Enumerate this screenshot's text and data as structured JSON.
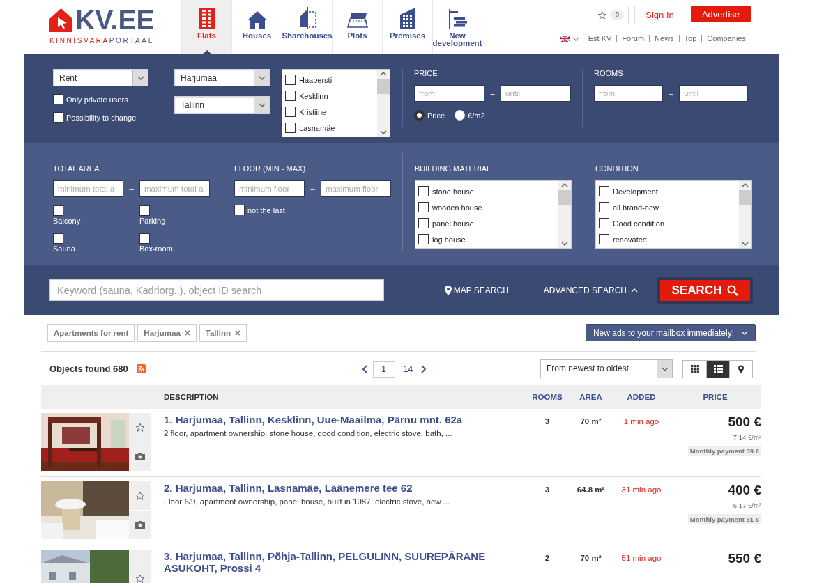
{
  "logo": {
    "brand": "KV.EE",
    "tagline_accent": "KINNISVARA",
    "tagline_rest": "PORTAAL"
  },
  "categories": [
    {
      "label": "Flats",
      "selected": true
    },
    {
      "label": "Houses",
      "selected": false
    },
    {
      "label": "Sharehouses",
      "selected": false
    },
    {
      "label": "Plots",
      "selected": false
    },
    {
      "label": "Premises",
      "selected": false
    },
    {
      "label": "New development",
      "selected": false
    }
  ],
  "account": {
    "favorites_count": "0",
    "sign_in": "Sign In",
    "advertise": "Advertise"
  },
  "top_links": [
    "Est KV",
    "Forum",
    "News",
    "Top",
    "Companies"
  ],
  "filters": {
    "deal": "Rent",
    "deal_options": [
      {
        "label": "Only private users",
        "checked": false
      },
      {
        "label": "Possibility to change",
        "checked": false
      }
    ],
    "county": "Harjumaa",
    "city": "Tallinn",
    "districts": [
      {
        "label": "Haabersti",
        "checked": false
      },
      {
        "label": "Kesklinn",
        "checked": false
      },
      {
        "label": "Kristiine",
        "checked": false
      },
      {
        "label": "Lasnamäe",
        "checked": false
      }
    ],
    "price": {
      "title": "PRICE",
      "from": {
        "placeholder": "from"
      },
      "until": {
        "placeholder": "until"
      },
      "dash": "–",
      "modes": [
        {
          "label": "Price",
          "selected": true
        },
        {
          "label": "€/m2",
          "selected": false
        }
      ]
    },
    "rooms": {
      "title": "ROOMS",
      "from": {
        "placeholder": "from"
      },
      "until": {
        "placeholder": "until"
      },
      "dash": "–"
    },
    "total_area": {
      "title": "TOTAL AREA",
      "min": {
        "placeholder": "minimum total a"
      },
      "max": {
        "placeholder": "maximum total a"
      },
      "dash": "–",
      "extras": [
        {
          "label": "Balcony",
          "checked": false
        },
        {
          "label": "Parking",
          "checked": false
        },
        {
          "label": "Sauna",
          "checked": false
        },
        {
          "label": "Box-room",
          "checked": false
        }
      ]
    },
    "floor": {
      "title": "FLOOR (MIN - MAX)",
      "min": {
        "placeholder": "minimum floor"
      },
      "max": {
        "placeholder": "maximum floor"
      },
      "dash": "–",
      "options": [
        {
          "label": "not the last",
          "checked": false
        }
      ]
    },
    "building_material": {
      "title": "BUILDING MATERIAL",
      "items": [
        {
          "label": "stone house",
          "checked": false
        },
        {
          "label": "wooden house",
          "checked": false
        },
        {
          "label": "panel house",
          "checked": false
        },
        {
          "label": "log house",
          "checked": false
        }
      ]
    },
    "condition": {
      "title": "CONDITION",
      "items": [
        {
          "label": "Development",
          "checked": false
        },
        {
          "label": "all brand-new",
          "checked": false
        },
        {
          "label": "Good condition",
          "checked": false
        },
        {
          "label": "renovated",
          "checked": false
        }
      ]
    }
  },
  "search": {
    "placeholder": "Keyword (sauna, Kadriorg..), object ID search",
    "map_search": "MAP SEARCH",
    "advanced_search": "ADVANCED SEARCH",
    "button": "SEARCH"
  },
  "chips": [
    {
      "label": "Apartments for rent",
      "removable": false
    },
    {
      "label": "Harjumaa",
      "removable": true
    },
    {
      "label": "Tallinn",
      "removable": true
    }
  ],
  "mailbox_button": "New ads to your mailbox immediately!",
  "results": {
    "count": "Objects found 680",
    "page": "1",
    "total_pages": "14",
    "sort": "From newest to oldest",
    "views": [
      {
        "kind": "grid",
        "selected": false
      },
      {
        "kind": "list",
        "selected": true
      },
      {
        "kind": "map",
        "selected": false
      }
    ]
  },
  "table": {
    "columns": [
      "DESCRIPTION",
      "ROOMS",
      "AREA",
      "ADDED",
      "PRICE"
    ],
    "rows": [
      {
        "title": "1. Harjumaa, Tallinn, Kesklinn, Uue-Maailma, Pärnu mnt. 62a",
        "details": "2 floor, apartment ownership, stone house, good condition, electric stove, bath, ...",
        "rooms": "3",
        "area": "70 m²",
        "added": "1 min ago",
        "price": "500 €",
        "price_per_m2": "7.14 €/m²",
        "monthly": "Monthly payment 39 €"
      },
      {
        "title": "2. Harjumaa, Tallinn, Lasnamäe, Läänemere tee 62",
        "details": "Floor 6/9, apartment ownership, panel house, built in 1987, electric stove, new ...",
        "rooms": "3",
        "area": "64.8 m²",
        "added": "31 min ago",
        "price": "400 €",
        "price_per_m2": "6.17 €/m²",
        "monthly": "Monthly payment 31 €"
      },
      {
        "title": "3. Harjumaa, Tallinn, Põhja-Tallinn, PELGULINN, SUUREPÄRANE ASUKOHT, Prossi 4",
        "rooms": "2",
        "area": "70 m²",
        "added": "51 min ago",
        "price": "550 €"
      }
    ]
  }
}
